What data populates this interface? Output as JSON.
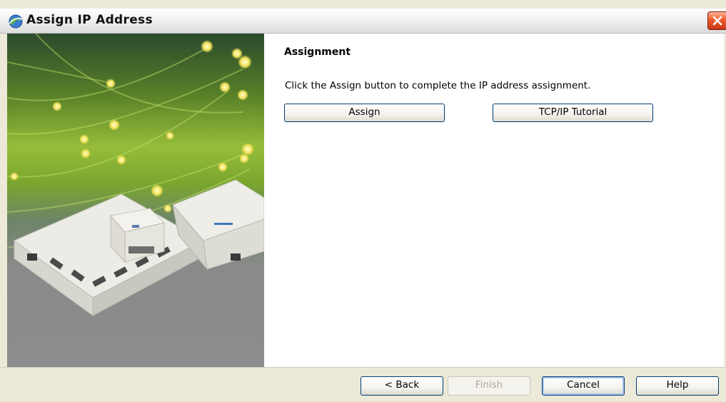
{
  "window": {
    "title": "Assign IP Address",
    "icon": "network-globe-icon",
    "close_icon": "close-x-icon"
  },
  "side_panel": {
    "image": "fiber-optic-device-server-illustration",
    "colors": {
      "fiber_green": "#8fc03a",
      "device_white": "#e9e8e2"
    }
  },
  "content": {
    "heading": "Assignment",
    "instruction": "Click the Assign button to complete the IP address assignment.",
    "assign_label": "Assign",
    "tutorial_label": "TCP/IP Tutorial"
  },
  "footer": {
    "back_label": "< Back",
    "finish_label": "Finish",
    "cancel_label": "Cancel",
    "help_label": "Help"
  },
  "colors": {
    "chrome": "#ece9d8",
    "close_button": "#e0532a",
    "button_border": "#003c74",
    "disabled_text": "#aca899"
  }
}
